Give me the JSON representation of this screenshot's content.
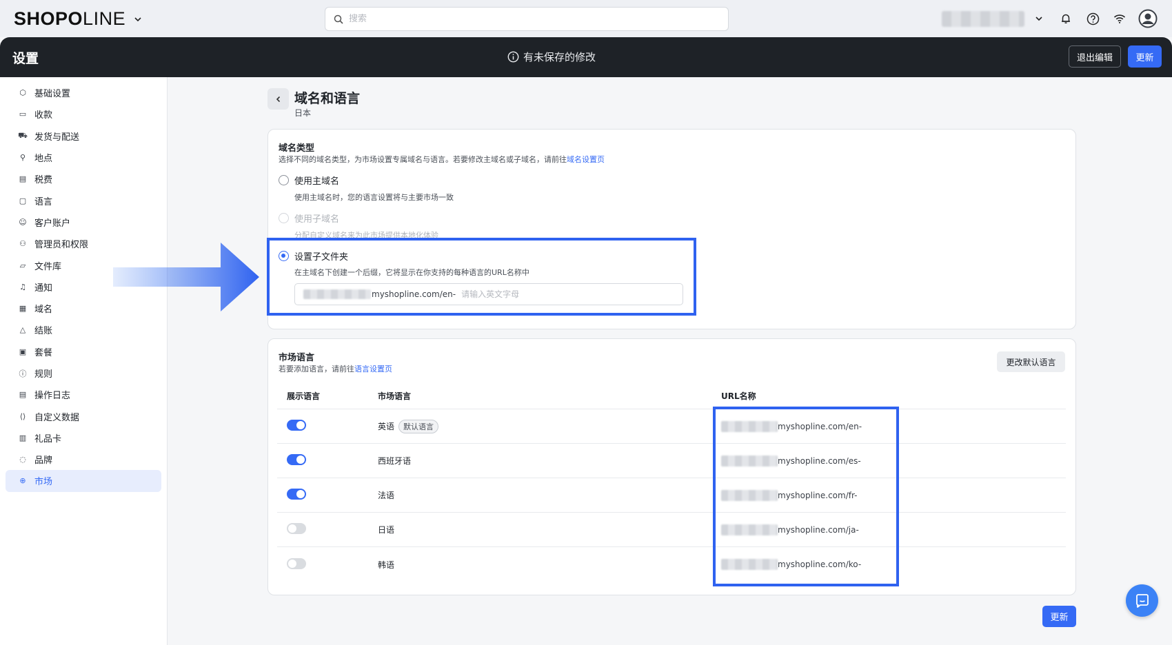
{
  "app": {
    "logo_bold": "SHOP",
    "logo_o": "O",
    "logo_thin": "LINE",
    "search_placeholder": "搜索"
  },
  "header": {
    "title": "设置",
    "unsaved_notice": "有未保存的修改",
    "exit_edit_label": "退出编辑",
    "update_label": "更新"
  },
  "sidebar": {
    "items": [
      {
        "label": "基础设置",
        "icon": "settings-hex-icon"
      },
      {
        "label": "收款",
        "icon": "wallet-icon"
      },
      {
        "label": "发货与配送",
        "icon": "truck-icon"
      },
      {
        "label": "地点",
        "icon": "location-pin-icon"
      },
      {
        "label": "税费",
        "icon": "receipt-icon"
      },
      {
        "label": "语言",
        "icon": "chat-icon"
      },
      {
        "label": "客户账户",
        "icon": "user-icon"
      },
      {
        "label": "管理员和权限",
        "icon": "admin-icon"
      },
      {
        "label": "文件库",
        "icon": "folder-icon"
      },
      {
        "label": "通知",
        "icon": "bell-icon"
      },
      {
        "label": "域名",
        "icon": "domain-icon"
      },
      {
        "label": "结账",
        "icon": "bag-icon"
      },
      {
        "label": "套餐",
        "icon": "plan-icon"
      },
      {
        "label": "规则",
        "icon": "info-circle-icon"
      },
      {
        "label": "操作日志",
        "icon": "log-icon"
      },
      {
        "label": "自定义数据",
        "icon": "code-brackets-icon"
      },
      {
        "label": "礼品卡",
        "icon": "gift-card-icon"
      },
      {
        "label": "品牌",
        "icon": "brand-icon"
      },
      {
        "label": "市场",
        "icon": "globe-icon",
        "active": true
      }
    ]
  },
  "page": {
    "title": "域名和语言",
    "subtitle": "日本"
  },
  "domain_type": {
    "title": "域名类型",
    "desc_prefix": "选择不同的域名类型，为市场设置专属域名与语言。若要修改主域名或子域名，请前往",
    "desc_link": "域名设置页",
    "options": [
      {
        "label": "使用主域名",
        "desc": "使用主域名时，您的语言设置将与主要市场一致",
        "state": "unchecked"
      },
      {
        "label": "使用子域名",
        "desc": "分配自定义域名来为此市场提供本地化体验",
        "state": "disabled"
      },
      {
        "label": "设置子文件夹",
        "desc": "在主域名下创建一个后缀，它将显示在你支持的每种语言的URL名称中",
        "state": "checked"
      }
    ],
    "subfolder_prefix": "myshopline.com/en-",
    "subfolder_placeholder": "请输入英文字母"
  },
  "market_language": {
    "title": "市场语言",
    "desc_prefix": "若要添加语言，请前往",
    "desc_link": "语言设置页",
    "change_default_label": "更改默认语言",
    "columns": [
      "展示语言",
      "市场语言",
      "URL名称"
    ],
    "default_badge": "默认语言",
    "rows": [
      {
        "language": "英语",
        "url": "myshopline.com/en-",
        "enabled": true,
        "is_default": true
      },
      {
        "language": "西班牙语",
        "url": "myshopline.com/es-",
        "enabled": true,
        "is_default": false
      },
      {
        "language": "法语",
        "url": "myshopline.com/fr-",
        "enabled": true,
        "is_default": false
      },
      {
        "language": "日语",
        "url": "myshopline.com/ja-",
        "enabled": false,
        "is_default": false
      },
      {
        "language": "韩语",
        "url": "myshopline.com/ko-",
        "enabled": false,
        "is_default": false
      }
    ]
  },
  "footer": {
    "update_label": "更新"
  },
  "colors": {
    "accent": "#356af5",
    "highlight": "#2f62f0",
    "dark_header": "#1e2227"
  }
}
